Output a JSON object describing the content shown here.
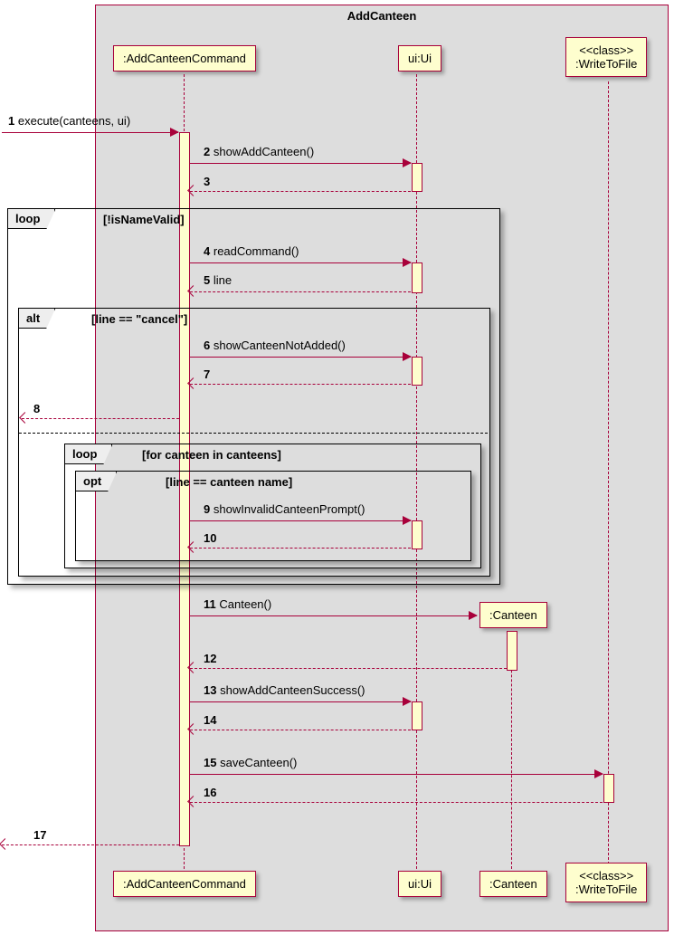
{
  "frame": {
    "title": "AddCanteen"
  },
  "participants": {
    "addCanteenCommand_top": ":AddCanteenCommand",
    "ui_top": "ui:Ui",
    "writeToFile_top_stereo": "<<class>>",
    "writeToFile_top_name": ":WriteToFile",
    "canteen_obj": ":Canteen",
    "addCanteenCommand_bot": ":AddCanteenCommand",
    "ui_bot": "ui:Ui",
    "canteen_bot": ":Canteen",
    "writeToFile_bot_stereo": "<<class>>",
    "writeToFile_bot_name": ":WriteToFile"
  },
  "frags": {
    "loop1_label": "loop",
    "loop1_guard": "[!isNameValid]",
    "alt_label": "alt",
    "alt_guard": "[line == \"cancel\"]",
    "loop2_label": "loop",
    "loop2_guard": "[for canteen in canteens]",
    "opt_label": "opt",
    "opt_guard": "[line == canteen name]"
  },
  "msgs": {
    "m1_num": "1",
    "m1_text": "execute(canteens, ui)",
    "m2_num": "2",
    "m2_text": "showAddCanteen()",
    "m3_num": "3",
    "m4_num": "4",
    "m4_text": "readCommand()",
    "m5_num": "5",
    "m5_text": "line",
    "m6_num": "6",
    "m6_text": "showCanteenNotAdded()",
    "m7_num": "7",
    "m8_num": "8",
    "m9_num": "9",
    "m9_text": "showInvalidCanteenPrompt()",
    "m10_num": "10",
    "m11_num": "11",
    "m11_text": "Canteen()",
    "m12_num": "12",
    "m13_num": "13",
    "m13_text": "showAddCanteenSuccess()",
    "m14_num": "14",
    "m15_num": "15",
    "m15_text": "saveCanteen()",
    "m16_num": "16",
    "m17_num": "17"
  }
}
